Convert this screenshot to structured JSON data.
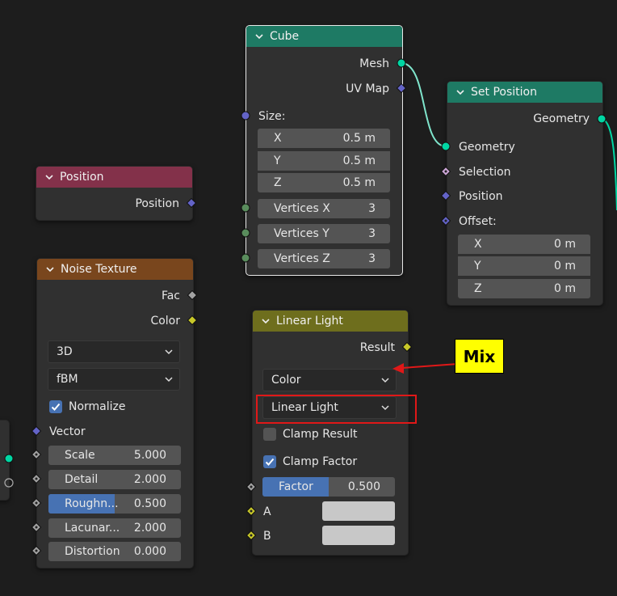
{
  "nodes": {
    "cube": {
      "title": "Cube",
      "outputs": [
        "Mesh",
        "UV Map"
      ],
      "size_label": "Size:",
      "size_fields": [
        {
          "label": "X",
          "value": "0.5 m"
        },
        {
          "label": "Y",
          "value": "0.5 m"
        },
        {
          "label": "Z",
          "value": "0.5 m"
        }
      ],
      "vertex_fields": [
        {
          "label": "Vertices X",
          "value": "3"
        },
        {
          "label": "Vertices Y",
          "value": "3"
        },
        {
          "label": "Vertices Z",
          "value": "3"
        }
      ]
    },
    "set_position": {
      "title": "Set Position",
      "output": "Geometry",
      "inputs": [
        "Geometry",
        "Selection",
        "Position"
      ],
      "offset_label": "Offset:",
      "offset_fields": [
        {
          "label": "X",
          "value": "0 m"
        },
        {
          "label": "Y",
          "value": "0 m"
        },
        {
          "label": "Z",
          "value": "0 m"
        }
      ]
    },
    "position": {
      "title": "Position",
      "output": "Position"
    },
    "noise": {
      "title": "Noise Texture",
      "outputs": [
        "Fac",
        "Color"
      ],
      "dimensions": "3D",
      "type": "fBM",
      "normalize_label": "Normalize",
      "vector_label": "Vector",
      "fields": [
        {
          "label": "Scale",
          "value": "5.000"
        },
        {
          "label": "Detail",
          "value": "2.000"
        },
        {
          "label": "Roughn...",
          "value": "0.500",
          "fill": 0.5
        },
        {
          "label": "Lacunar...",
          "value": "2.000"
        },
        {
          "label": "Distortion",
          "value": "0.000"
        }
      ]
    },
    "linear_light": {
      "title": "Linear Light",
      "output": "Result",
      "data_type": "Color",
      "blend_mode": "Linear Light",
      "clamp_result_label": "Clamp Result",
      "clamp_factor_label": "Clamp Factor",
      "factor_label": "Factor",
      "factor_value": "0.500",
      "factor_fill": 0.5,
      "input_a": "A",
      "input_b": "B"
    }
  },
  "annotation": {
    "label": "Mix"
  },
  "colors": {
    "geometry_socket": "#00d6a3",
    "vector_socket": "#6363c7",
    "float_socket": "#a1a1a1",
    "int_socket": "#598c5c",
    "color_socket": "#c7c729",
    "bool_socket": "#cca6d6",
    "cube_header": "#1e7a64",
    "set_position_header": "#1e7a64",
    "position_header": "#83314a",
    "noise_header": "#79461d",
    "linear_light_header": "#6e6e1d",
    "accent": "#4772b3",
    "annotation_red": "#e01818",
    "annotation_yellow": "#ffff00"
  }
}
